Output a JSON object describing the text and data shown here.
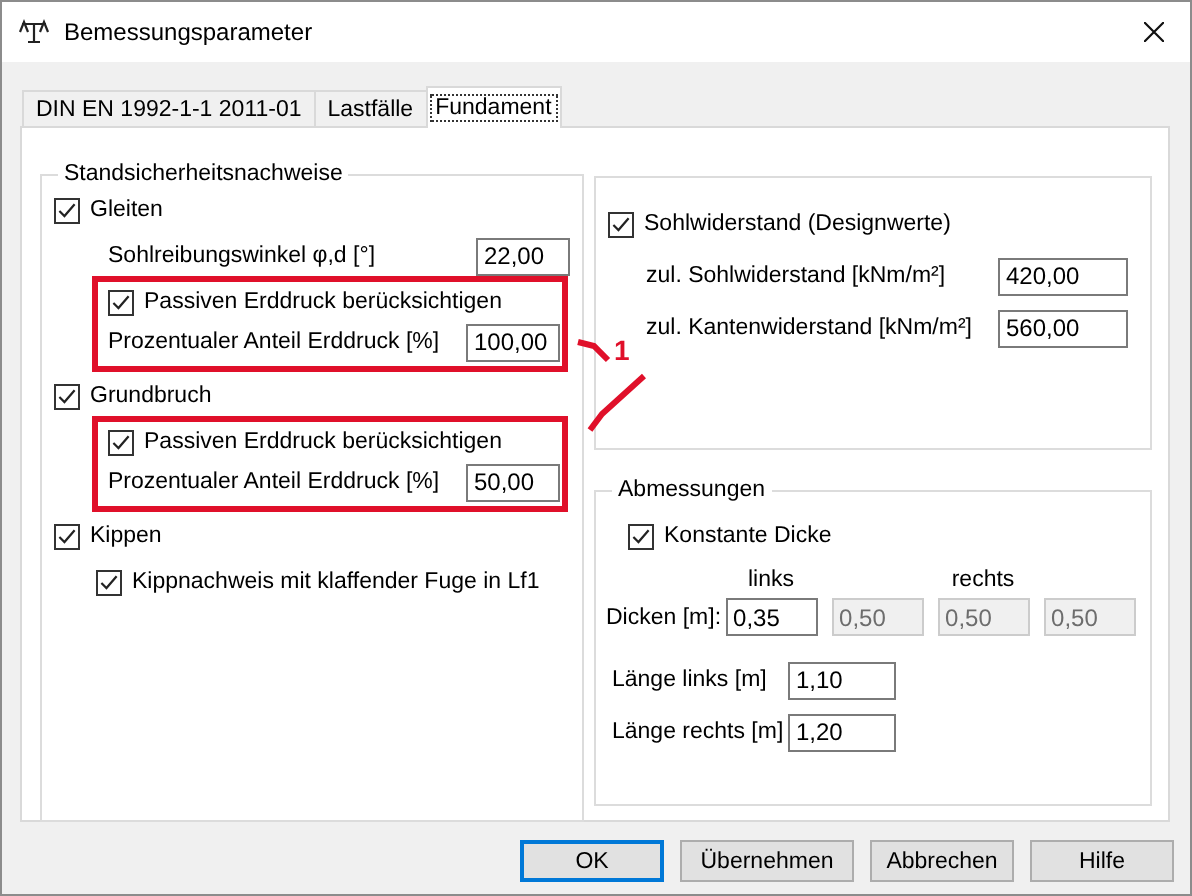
{
  "window": {
    "title": "Bemessungsparameter"
  },
  "tabs": [
    {
      "label": "DIN EN 1992-1-1 2011-01",
      "selected": false
    },
    {
      "label": "Lastfälle",
      "selected": false
    },
    {
      "label": "Fundament",
      "selected": true
    }
  ],
  "stability": {
    "title": "Standsicherheitsnachweise",
    "sections": [
      {
        "label": "Gleiten",
        "checked": true,
        "fields": [
          {
            "label": "Sohlreibungswinkel φ,d [°]",
            "value": "22,00"
          }
        ],
        "passive": {
          "label": "Passiven Erddruck berücksichtigen",
          "checked": true,
          "highlighted": true,
          "field": {
            "label": "Prozentualer Anteil Erddruck [%]",
            "value": "100,00"
          }
        }
      },
      {
        "label": "Grundbruch",
        "checked": true,
        "passive": {
          "label": "Passiven Erddruck berücksichtigen",
          "checked": true,
          "highlighted": true,
          "field": {
            "label": "Prozentualer Anteil Erddruck [%]",
            "value": "50,00"
          }
        }
      },
      {
        "label": "Kippen",
        "checked": true,
        "subchecks": [
          {
            "label": "Kippnachweis mit klaffender Fuge in Lf1",
            "checked": true
          }
        ]
      }
    ]
  },
  "soil_resistance": {
    "label": "Sohlwiderstand (Designwerte)",
    "checked": true,
    "fields": [
      {
        "label": "zul. Sohlwiderstand [kNm/m²]",
        "value": "420,00"
      },
      {
        "label": "zul. Kantenwiderstand [kNm/m²]",
        "value": "560,00"
      }
    ]
  },
  "dimensions": {
    "title": "Abmessungen",
    "constant": {
      "label": "Konstante Dicke",
      "checked": true
    },
    "thickness": {
      "label": "Dicken [m]:",
      "values": [
        {
          "header": "links",
          "value": "0,35",
          "disabled": false
        },
        {
          "value": "0,50",
          "disabled": true
        },
        {
          "header": "rechts",
          "value": "0,50",
          "disabled": true
        },
        {
          "value": "0,50",
          "disabled": true
        }
      ]
    },
    "lengths": [
      {
        "label": "Länge links [m]",
        "value": "1,10"
      },
      {
        "label": "Länge rechts [m]",
        "value": "1,20"
      }
    ]
  },
  "callout": {
    "label": "1"
  },
  "buttons": [
    {
      "label": "OK",
      "default": true
    },
    {
      "label": "Übernehmen",
      "default": false
    },
    {
      "label": "Abbrechen",
      "default": false
    },
    {
      "label": "Hilfe",
      "default": false
    }
  ]
}
